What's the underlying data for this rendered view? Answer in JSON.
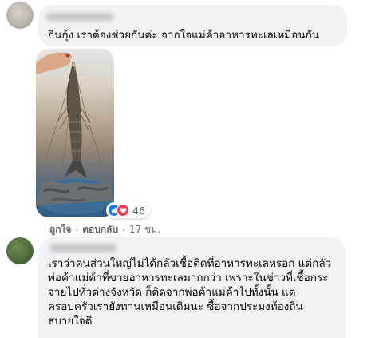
{
  "comments": [
    {
      "text": "กินกุ้ง เราต้องช่วยกันค่ะ จากใจแม่ค้าอาหารทะเลเหมือนกัน",
      "photo_icon": "shrimp-photo",
      "reactions": {
        "icons": [
          "like-icon",
          "love-icon"
        ],
        "count": "46"
      },
      "actions": {
        "like": "ถูกใจ",
        "reply": "ตอบกลับ",
        "time": "17 ชม."
      }
    },
    {
      "text": "เราว่าคนส่วนใหญ่ไม่ได้กลัวเชื้อติดที่อาหารทะเลหรอก แต่กลัว\nพ่อค้าแม่ค้าที่ขายอาหารทะเลมากกว่า เพราะในข่าวที่เชื้อกระ\nจายไปทั่วต่างจังหวัด ก็ติดจากพ่อค้าแม่ค้าไปทั้งนั้น แต่\nครอบครัวเรายังทานเหมือนเดิมนะ ซื้อจากประมงท้องถิ่น\nสบายใจดี"
    }
  ],
  "colors": {
    "bubble": "#f0f2f5",
    "like": "#1877f2",
    "love": "#f33e58",
    "meta": "#65676b"
  }
}
